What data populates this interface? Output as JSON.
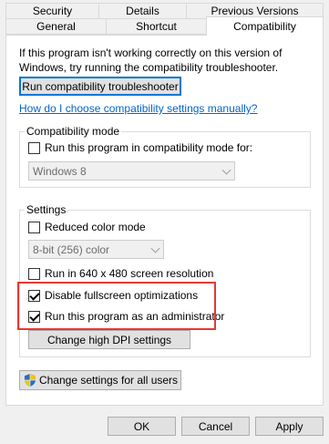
{
  "tabs": {
    "row1": [
      "Security",
      "Details",
      "Previous Versions"
    ],
    "row2": [
      "General",
      "Shortcut",
      "Compatibility"
    ]
  },
  "intro_text": "If this program isn't working correctly on this version of Windows, try running the compatibility troubleshooter.",
  "troubleshooter_button": "Run compatibility troubleshooter",
  "manual_link": "How do I choose compatibility settings manually?",
  "compat_mode": {
    "label": "Compatibility mode",
    "checkbox_label": "Run this program in compatibility mode for:",
    "checked": false,
    "selected_os": "Windows 8"
  },
  "settings": {
    "label": "Settings",
    "reduced_color": {
      "label": "Reduced color mode",
      "checked": false
    },
    "color_select": "8-bit (256) color",
    "resolution_640": {
      "label": "Run in 640 x 480 screen resolution",
      "checked": false
    },
    "disable_fullscreen": {
      "label": "Disable fullscreen optimizations",
      "checked": true
    },
    "run_as_admin": {
      "label": "Run this program as an administrator",
      "checked": true
    },
    "dpi_button": "Change high DPI settings"
  },
  "all_users_button": "Change settings for all users",
  "footer": {
    "ok": "OK",
    "cancel": "Cancel",
    "apply": "Apply"
  },
  "colors": {
    "highlight": "#e53935",
    "link": "#0066cc",
    "default_border": "#0078d7"
  }
}
